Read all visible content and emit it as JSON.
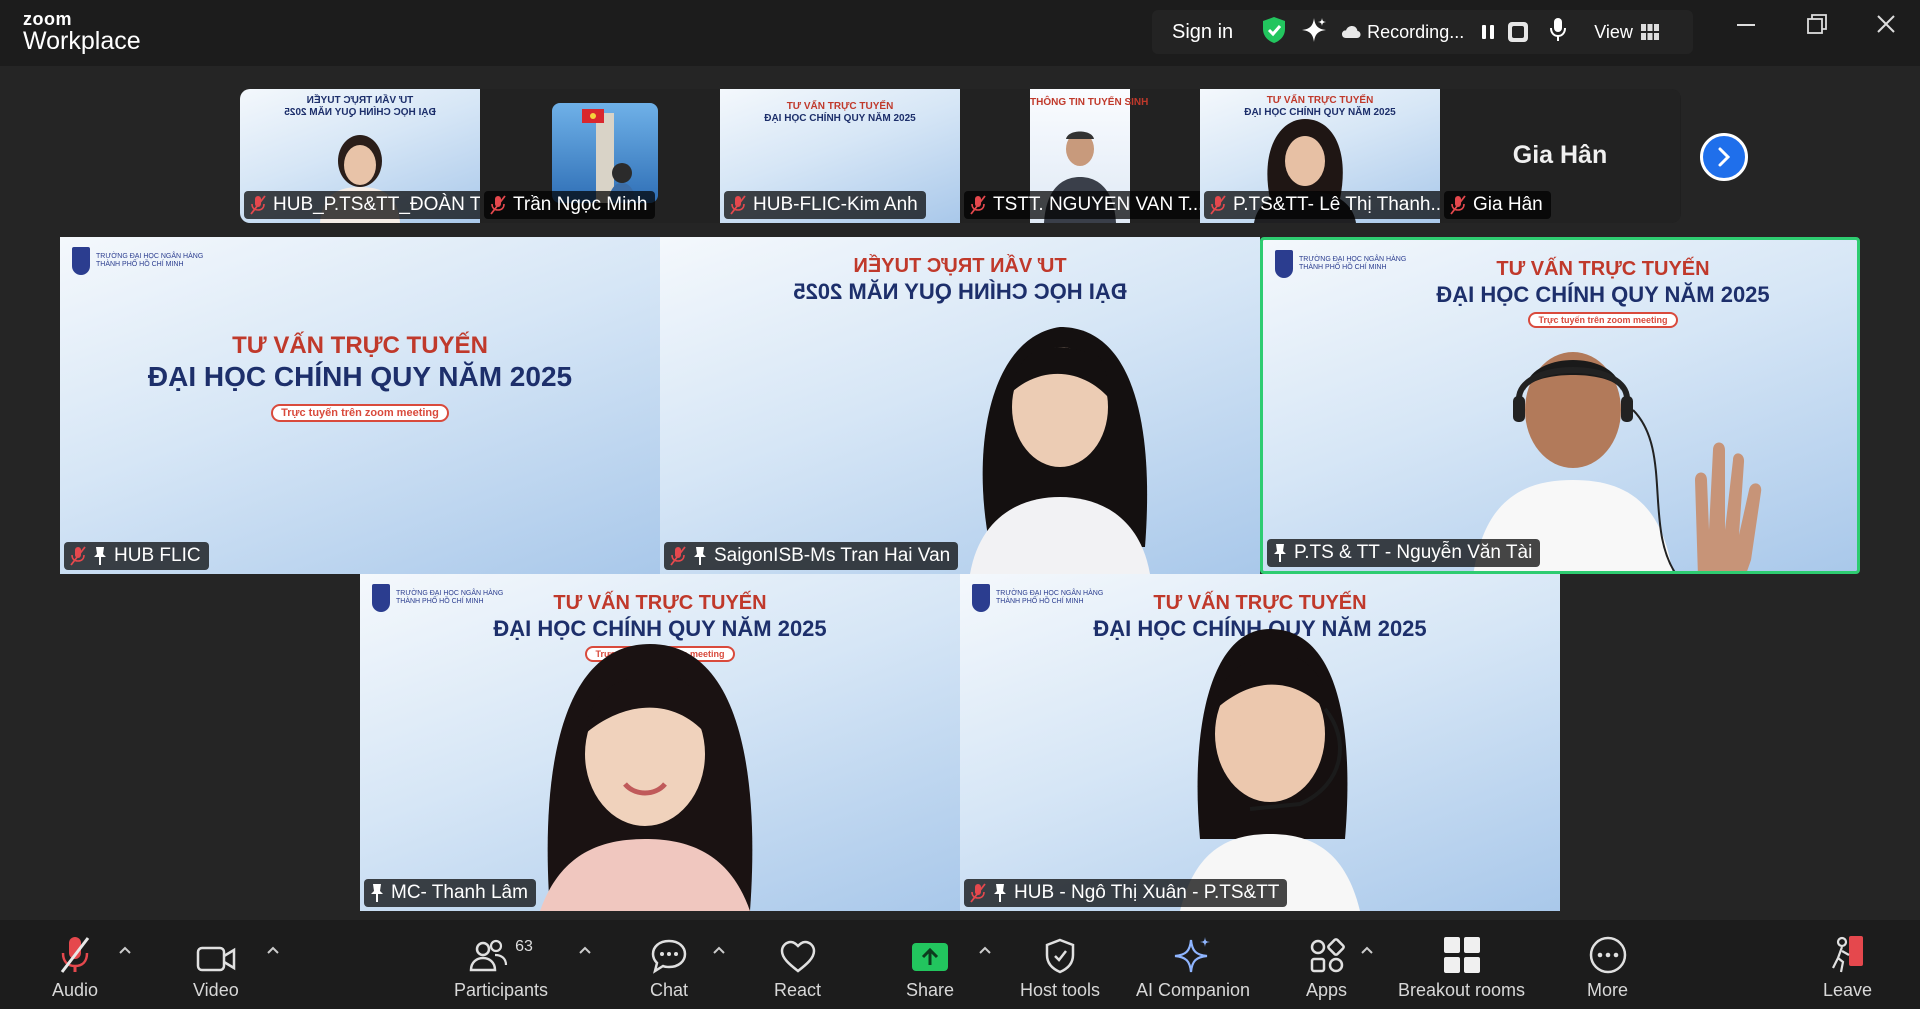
{
  "app": {
    "logo_line1": "zoom",
    "logo_line2": "Workplace"
  },
  "topbar": {
    "sign_in": "Sign in",
    "recording_label": "Recording...",
    "view_label": "View"
  },
  "thumbnails": [
    {
      "name": "HUB_P.TS&TT_ĐOÀN T..."
    },
    {
      "name": "Trần Ngọc Minh"
    },
    {
      "name": "HUB-FLIC-Kim Anh"
    },
    {
      "name": "TSTT. NGUYEN VAN T..."
    },
    {
      "name": "P.TS&TT- Lê Thị Thanh..."
    },
    {
      "name": "Gia Hân",
      "display": "Gia Hân"
    }
  ],
  "thumb_slide_texts": {
    "mirrored_title": "TƯ VẤN TRỰC TUYẾN",
    "mirrored_sub": "ĐẠI HỌC CHÍNH QUY NĂM 2025",
    "small_title": "TƯ VẤN TRỰC TUYẾN",
    "small_sub": "ĐẠI HỌC CHÍNH QUY NĂM 2025",
    "info_title": "THÔNG TIN TUYỂN SINH"
  },
  "tiles": {
    "hub_flic": {
      "name": "HUB FLIC",
      "title": "TƯ VẤN TRỰC TUYẾN",
      "subtitle": "ĐẠI HỌC CHÍNH QUY NĂM 2025",
      "pill": "Trực tuyến trên zoom meeting"
    },
    "saigon": {
      "name": "SaigonISB-Ms Tran Hai Van",
      "title": "TƯ VẤN TRỰC TUYẾN",
      "subtitle": "ĐẠI HỌC CHÍNH QUY NĂM 2025"
    },
    "nguyen_van_tai": {
      "name": "P.TS & TT - Nguyễn Văn Tài",
      "title": "TƯ VẤN TRỰC TUYẾN",
      "subtitle": "ĐẠI HỌC CHÍNH QUY NĂM 2025",
      "pill": "Trực tuyến trên zoom meeting"
    },
    "thanh_lam": {
      "name": "MC- Thanh Lâm",
      "title": "TƯ VẤN TRỰC TUYẾN",
      "subtitle": "ĐẠI HỌC CHÍNH QUY NĂM 2025",
      "pill": "Trực tuyến trên zoom meeting"
    },
    "ngo_thi_xuan": {
      "name": "HUB - Ngô Thị Xuân - P.TS&TT",
      "title": "TƯ VẤN TRỰC TUYẾN",
      "subtitle": "ĐẠI HỌC CHÍNH QUY NĂM 2025"
    }
  },
  "toolbar": {
    "audio": "Audio",
    "video": "Video",
    "participants": "Participants",
    "participants_count": "63",
    "chat": "Chat",
    "react": "React",
    "share": "Share",
    "host_tools": "Host tools",
    "ai_companion": "AI Companion",
    "apps": "Apps",
    "breakout_rooms": "Breakout rooms",
    "more": "More",
    "leave": "Leave"
  },
  "colors": {
    "accent_green": "#2ecc71",
    "share_green": "#22c55e",
    "next_blue": "#1f6feb",
    "muted_red": "#e5484d"
  }
}
